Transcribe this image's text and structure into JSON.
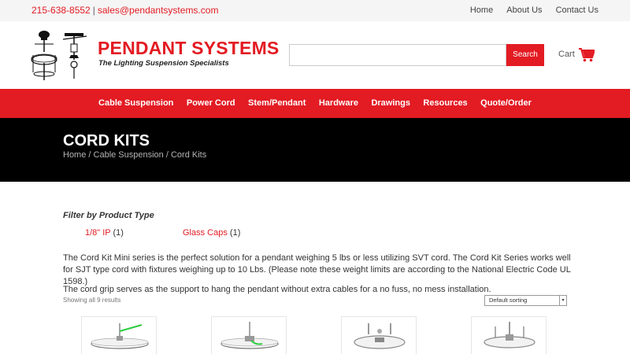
{
  "topbar": {
    "phone": "215-638-8552",
    "separator": "|",
    "email": "sales@pendantsystems.com",
    "links": [
      "Home",
      "About Us",
      "Contact Us"
    ]
  },
  "header": {
    "brand_name": "PENDANT SYSTEMS",
    "tagline": "The Lighting Suspension Specialists",
    "search_button": "Search",
    "search_placeholder": "",
    "cart_label": "Cart"
  },
  "nav": {
    "items": [
      "Cable Suspension",
      "Power Cord",
      "Stem/Pendant",
      "Hardware",
      "Drawings",
      "Resources",
      "Quote/Order"
    ]
  },
  "page": {
    "title": "CORD KITS",
    "breadcrumb": "Home / Cable Suspension / Cord Kits"
  },
  "filter": {
    "title": "Filter by Product Type",
    "items": [
      {
        "label": "1/8\" IP",
        "count": "(1)"
      },
      {
        "label": "Glass Caps",
        "count": "(1)"
      }
    ]
  },
  "description": {
    "paragraph1": "The Cord Kit Mini series is the perfect solution for a pendant weighing 5 lbs or less utilizing SVT cord.  The Cord Kit Series works well for SJT type cord with fixtures weighing up to 10 Lbs.  (Please note these weight limits are according to the National Electric Code UL 1598.)",
    "paragraph2": "The cord grip serves as the support to hang the pendant without extra cables for a no fuss, no mess installation."
  },
  "shop": {
    "results_text": "Showing all 9 results",
    "sort_selected": "Default sorting"
  },
  "colors": {
    "accent": "#e31b23",
    "banner": "#000000",
    "topbar": "#f5f5f5"
  }
}
